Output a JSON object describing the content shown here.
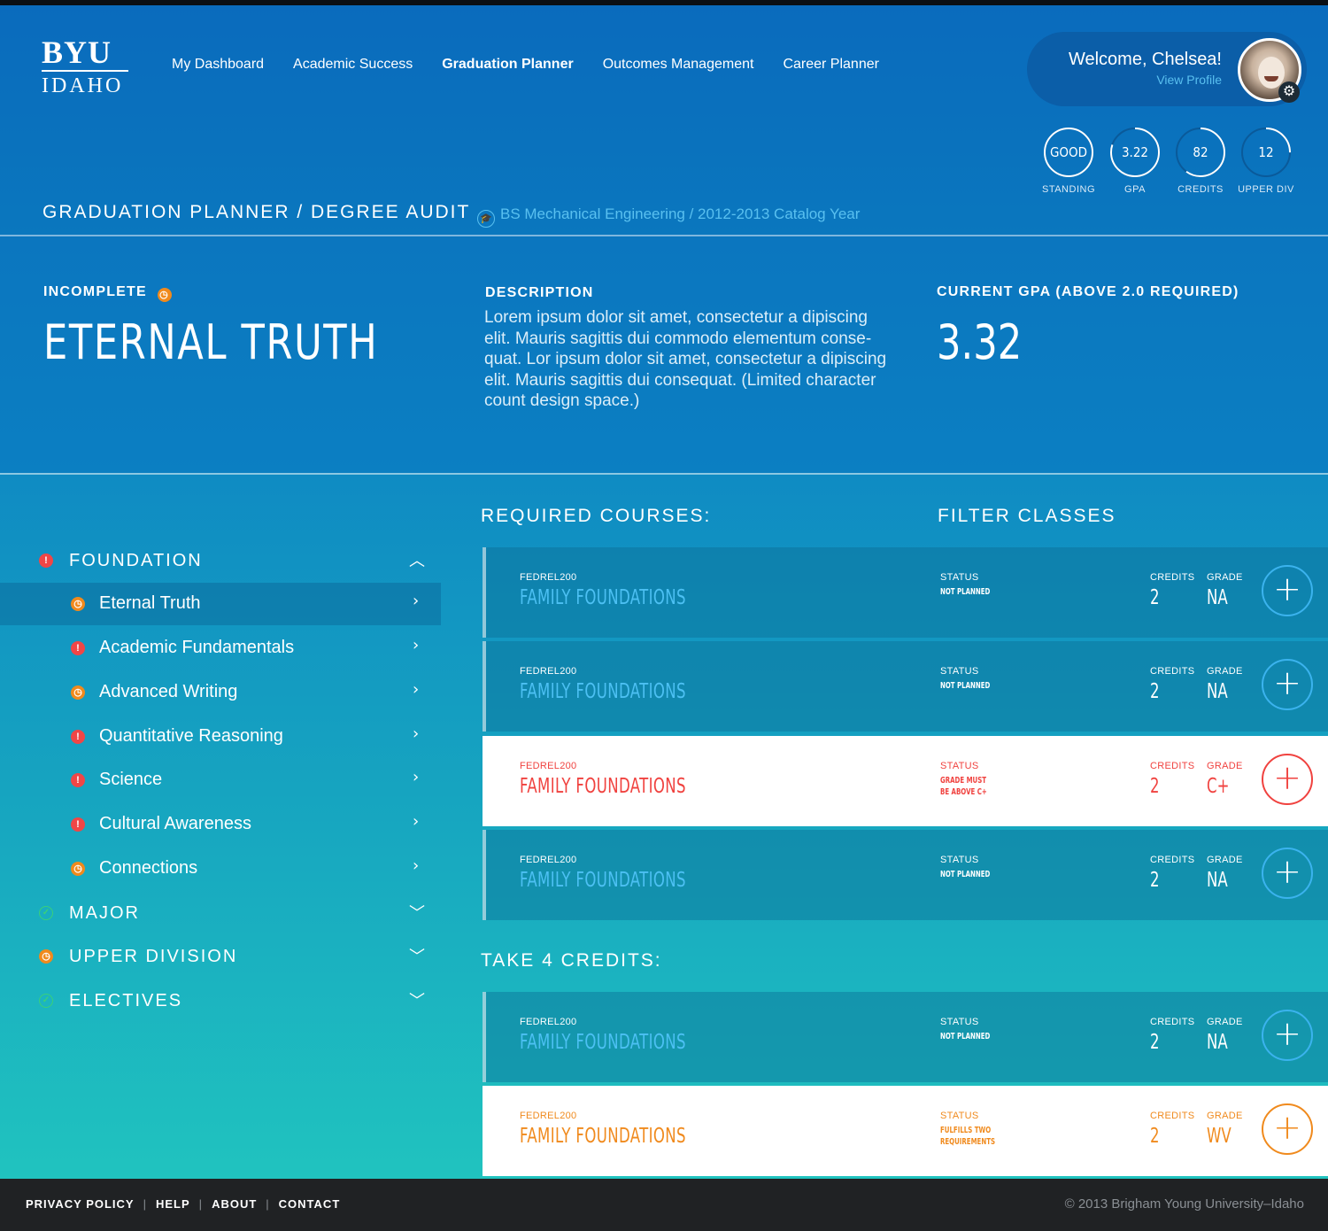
{
  "colors": {
    "brand_blue": "#0a6bbd",
    "accent_cyan": "#59c0f0",
    "warning_orange": "#f08a1d",
    "error_red": "#f0423f",
    "ok_green": "#3ad07a",
    "footer": "#202224"
  },
  "logo": {
    "line1": "BYU",
    "line2": "IDAHO"
  },
  "nav": [
    {
      "label": "My Dashboard",
      "active": false
    },
    {
      "label": "Academic Success",
      "active": false
    },
    {
      "label": "Graduation Planner",
      "active": true
    },
    {
      "label": "Outcomes Management",
      "active": false
    },
    {
      "label": "Career Planner",
      "active": false
    }
  ],
  "user": {
    "welcome": "Welcome, Chelsea!",
    "profile_link": "View Profile"
  },
  "stats": [
    {
      "value": "GOOD",
      "label": "STANDING",
      "fill": 1.0
    },
    {
      "value": "3.22",
      "label": "GPA",
      "fill": 0.8
    },
    {
      "value": "82",
      "label": "CREDITS",
      "fill": 0.6
    },
    {
      "value": "12",
      "label": "UPPER DIV",
      "fill": 0.25
    }
  ],
  "page": {
    "title": "GRADUATION PLANNER / DEGREE AUDIT",
    "catalog": "BS Mechanical Engineering / 2012-2013 Catalog Year"
  },
  "summary": {
    "status": "INCOMPLETE",
    "title": "ETERNAL TRUTH",
    "description_label": "DESCRIPTION",
    "description": "Lorem ipsum dolor sit amet, consectetur a dipiscing elit. Mauris sagittis dui commodo elementum conse-quat. Lor ipsum dolor sit amet, consectetur a dipiscing elit. Mauris sagittis dui consequat. (Limited character count design space.)",
    "gpa_label": "CURRENT GPA (ABOVE 2.0 REQUIRED)",
    "gpa": "3.32"
  },
  "sidebar": {
    "groups": [
      {
        "label": "FOUNDATION",
        "status": "red",
        "expanded": true
      },
      {
        "label": "MAJOR",
        "status": "green",
        "expanded": false
      },
      {
        "label": "UPPER DIVISION",
        "status": "orange",
        "expanded": false
      },
      {
        "label": "ELECTIVES",
        "status": "green",
        "expanded": false
      }
    ],
    "items": [
      {
        "label": "Eternal Truth",
        "status": "orange",
        "active": true
      },
      {
        "label": "Academic Fundamentals",
        "status": "red",
        "active": false
      },
      {
        "label": "Advanced Writing",
        "status": "orange",
        "active": false
      },
      {
        "label": "Quantitative Reasoning",
        "status": "red",
        "active": false
      },
      {
        "label": "Science",
        "status": "red",
        "active": false
      },
      {
        "label": "Cultural Awareness",
        "status": "red",
        "active": false
      },
      {
        "label": "Connections",
        "status": "orange",
        "active": false
      }
    ]
  },
  "required": {
    "heading": "REQUIRED COURSES:",
    "filter": "FILTER CLASSES",
    "labels": {
      "status": "STATUS",
      "credits": "CREDITS",
      "grade": "GRADE"
    },
    "courses": [
      {
        "code": "FEDREL200",
        "name": "FAMILY FOUNDATIONS",
        "status": "NOT PLANNED",
        "credits": "2",
        "grade": "NA",
        "style": "blue"
      },
      {
        "code": "FEDREL200",
        "name": "FAMILY FOUNDATIONS",
        "status": "NOT PLANNED",
        "credits": "2",
        "grade": "NA",
        "style": "blue"
      },
      {
        "code": "FEDREL200",
        "name": "FAMILY FOUNDATIONS",
        "status": "GRADE MUST BE ABOVE C+",
        "credits": "2",
        "grade": "C+",
        "style": "red"
      },
      {
        "code": "FEDREL200",
        "name": "FAMILY FOUNDATIONS",
        "status": "NOT PLANNED",
        "credits": "2",
        "grade": "NA",
        "style": "blue"
      }
    ]
  },
  "take": {
    "heading": "TAKE 4 CREDITS:",
    "courses": [
      {
        "code": "FEDREL200",
        "name": "FAMILY FOUNDATIONS",
        "status": "NOT PLANNED",
        "credits": "2",
        "grade": "NA",
        "style": "blue"
      },
      {
        "code": "FEDREL200",
        "name": "FAMILY FOUNDATIONS",
        "status": "FULFILLS TWO REQUIREMENTS",
        "credits": "2",
        "grade": "WV",
        "style": "orange"
      }
    ]
  },
  "footer": {
    "links": [
      "PRIVACY POLICY",
      "HELP",
      "ABOUT",
      "CONTACT"
    ],
    "copyright": "© 2013 Brigham Young University–Idaho"
  }
}
